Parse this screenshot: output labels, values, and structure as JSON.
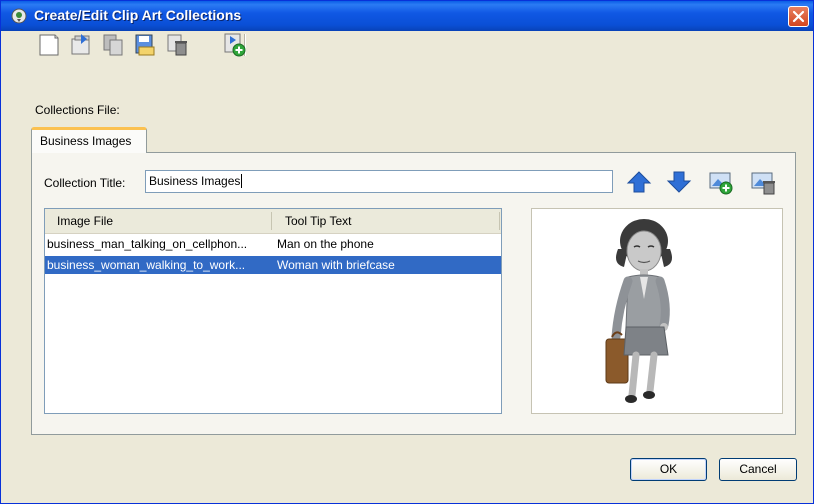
{
  "window": {
    "title": "Create/Edit Clip Art Collections",
    "title_icon": "clip-art-app-icon",
    "close_icon": "close-icon"
  },
  "toolbar": {
    "buttons": [
      {
        "name": "new-collection-icon"
      },
      {
        "name": "open-collection-icon"
      },
      {
        "name": "copy-collection-icon"
      },
      {
        "name": "save-collection-icon"
      },
      {
        "name": "delete-collection-icon"
      },
      {
        "name": "add-collection-icon"
      }
    ]
  },
  "collections_file_label": "Collections File:",
  "tabs": [
    {
      "label": "Business Images",
      "active": true
    }
  ],
  "collection_title": {
    "label": "Collection Title:",
    "value": "Business Images"
  },
  "row_actions": [
    {
      "name": "move-up-icon"
    },
    {
      "name": "move-down-icon"
    },
    {
      "name": "add-image-icon"
    },
    {
      "name": "remove-image-icon"
    }
  ],
  "table": {
    "headers": [
      "Image File",
      "Tool Tip Text"
    ],
    "rows": [
      {
        "file": "business_man_talking_on_cellphon...",
        "tooltip": "Man on the phone",
        "selected": false
      },
      {
        "file": "business_woman_walking_to_work...",
        "tooltip": "Woman with briefcase",
        "selected": true
      }
    ]
  },
  "preview": {
    "image": "businesswoman-walking-with-briefcase"
  },
  "buttons": {
    "ok": "OK",
    "cancel": "Cancel"
  },
  "colors": {
    "titlebar": "#0a4fd6",
    "selection": "#316ac5",
    "dialog_bg": "#ece9d8",
    "tab_highlight": "#fbc150"
  }
}
